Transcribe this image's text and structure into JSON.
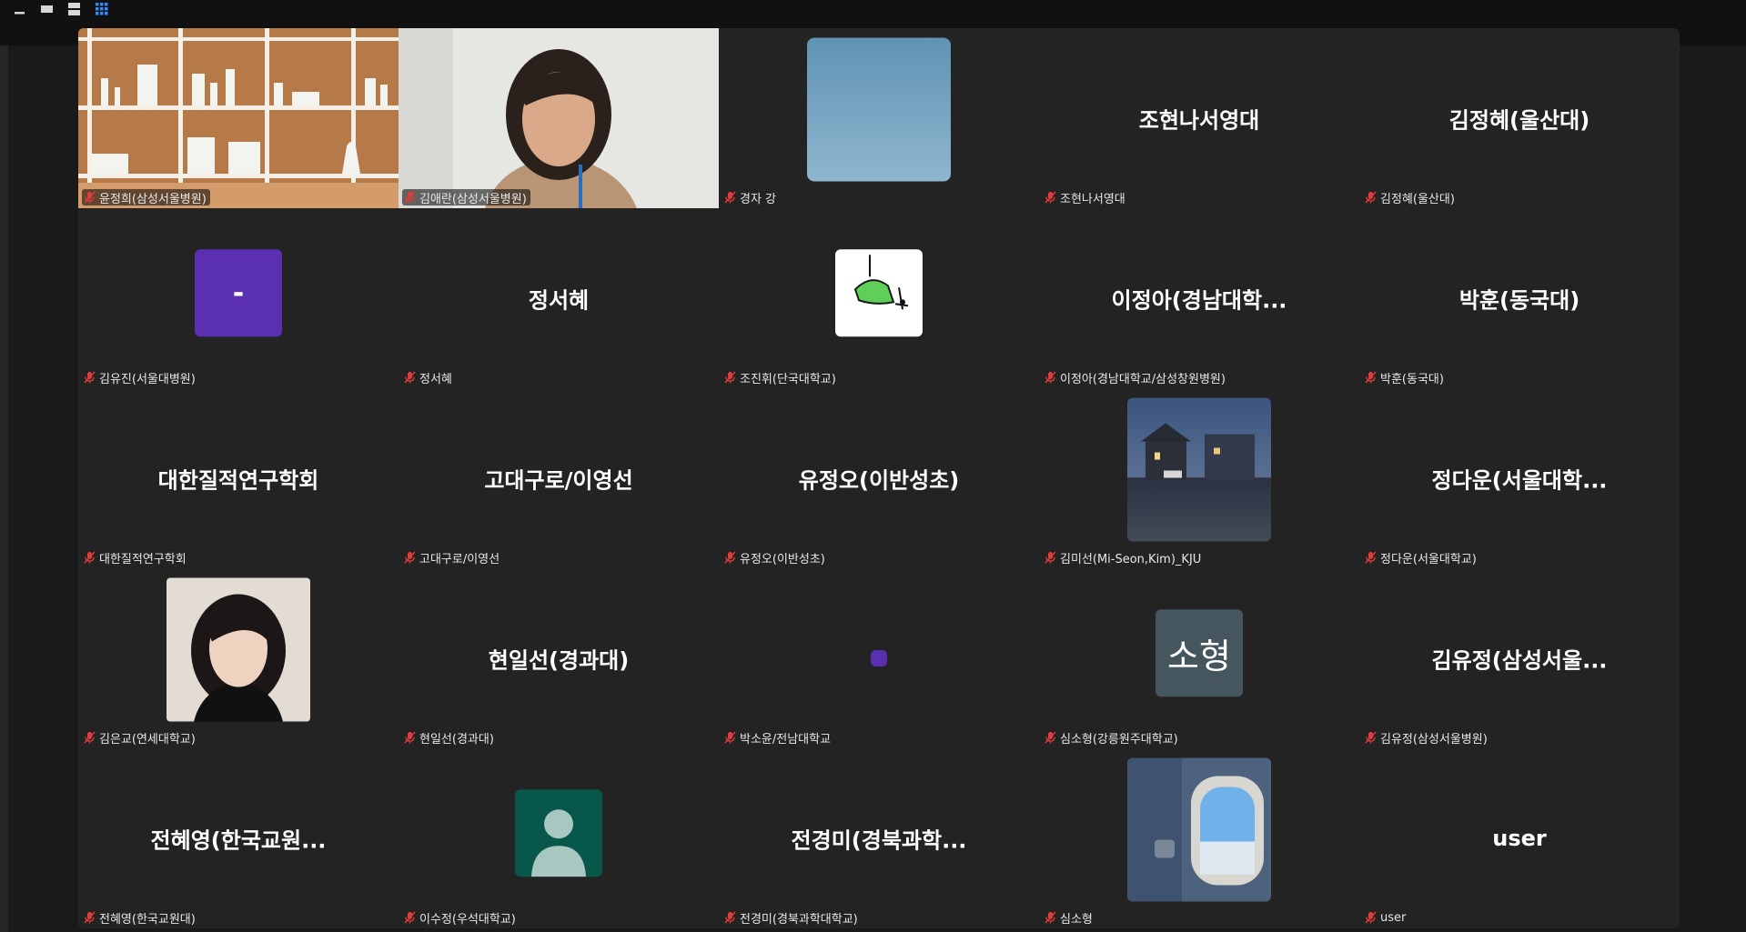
{
  "meeting": {
    "participants": [
      {
        "label": "윤정희(삼성서울병원)",
        "display_name": "",
        "tile_type": "video-shelf"
      },
      {
        "label": "김애란(삼성서울병원)",
        "display_name": "",
        "tile_type": "video-person"
      },
      {
        "label": "경자 강",
        "display_name": "",
        "tile_type": "photo-sky"
      },
      {
        "label": "조현나서영대",
        "display_name": "조현나서영대",
        "tile_type": "name"
      },
      {
        "label": "김정혜(울산대)",
        "display_name": "김정혜(울산대)",
        "tile_type": "name"
      },
      {
        "label": "김유진(서울대병원)",
        "display_name": "",
        "tile_type": "avatar-dash",
        "avatar_text": "-"
      },
      {
        "label": "정서혜",
        "display_name": "정서혜",
        "tile_type": "name"
      },
      {
        "label": "조진휘(단국대학교)",
        "display_name": "",
        "tile_type": "photo-drawing"
      },
      {
        "label": "이정아(경남대학교/삼성창원병원)",
        "display_name": "이정아(경남대학...",
        "tile_type": "name"
      },
      {
        "label": "박훈(동국대)",
        "display_name": "박훈(동국대)",
        "tile_type": "name"
      },
      {
        "label": "대한질적연구학회",
        "display_name": "대한질적연구학회",
        "tile_type": "name"
      },
      {
        "label": "고대구로/이영선",
        "display_name": "고대구로/이영선",
        "tile_type": "name"
      },
      {
        "label": "유정오(이반성초)",
        "display_name": "유정오(이반성초)",
        "tile_type": "name"
      },
      {
        "label": "김미선(Mi-Seon,Kim)_KJU",
        "display_name": "",
        "tile_type": "photo-night"
      },
      {
        "label": "정다운(서울대학교)",
        "display_name": "정다운(서울대학...",
        "tile_type": "name"
      },
      {
        "label": "김은교(연세대학교)",
        "display_name": "",
        "tile_type": "photo-portrait"
      },
      {
        "label": "현일선(경과대)",
        "display_name": "현일선(경과대)",
        "tile_type": "name"
      },
      {
        "label": "박소윤/전남대학교",
        "display_name": "",
        "tile_type": "avatar-dot"
      },
      {
        "label": "심소형(강릉원주대학교)",
        "display_name": "",
        "tile_type": "avatar-text",
        "avatar_text": "소형"
      },
      {
        "label": "김유정(삼성서울병원)",
        "display_name": "김유정(삼성서울...",
        "tile_type": "name"
      },
      {
        "label": "전혜영(한국교원대)",
        "display_name": "전혜영(한국교원...",
        "tile_type": "name"
      },
      {
        "label": "이수정(우석대학교)",
        "display_name": "",
        "tile_type": "avatar-person"
      },
      {
        "label": "전경미(경북과학대학교)",
        "display_name": "전경미(경북과학...",
        "tile_type": "name"
      },
      {
        "label": "심소형",
        "display_name": "",
        "tile_type": "photo-window"
      },
      {
        "label": "user",
        "display_name": "user",
        "tile_type": "name"
      }
    ]
  },
  "icons": {
    "muted_mic": "muted-mic-icon",
    "view_controls": [
      "minimize-icon",
      "single-view-icon",
      "speaker-view-icon",
      "gallery-view-icon"
    ]
  },
  "colors": {
    "background": "#1a1a1a",
    "tile": "#232323",
    "muted": "#e23c3c",
    "gallery_active": "#2d8cff",
    "avatar_purple": "#5a2fb0",
    "avatar_teal": "#07584a",
    "avatar_slate": "#46565f"
  }
}
